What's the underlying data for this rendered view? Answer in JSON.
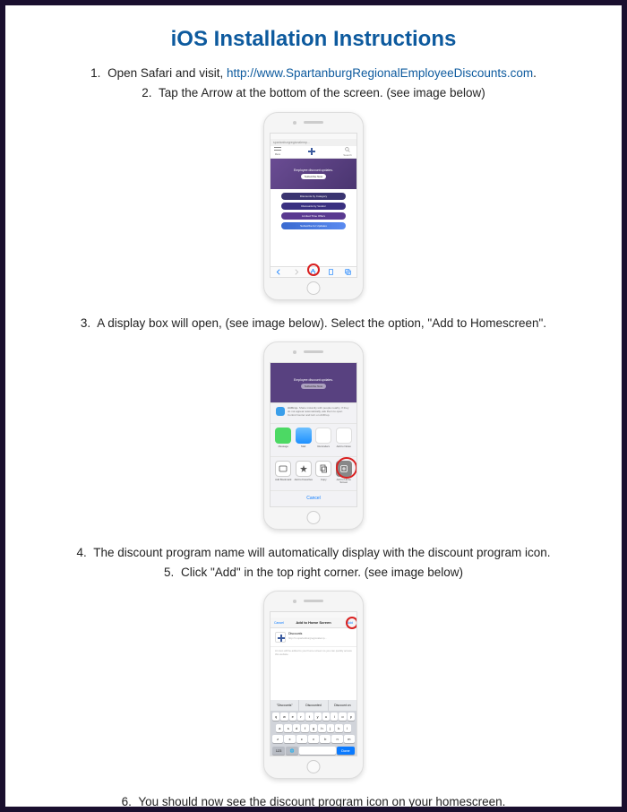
{
  "title": "iOS Installation Instructions",
  "steps": {
    "s1_pre": "Open Safari and visit, ",
    "s1_link": "http://www.SpartanburgRegionalEmployeeDiscounts.com",
    "s1_post": ".",
    "s2": "Tap the Arrow at the bottom of the screen. (see image below)",
    "s3": "A display box will open, (see image below).  Select the option, \"Add to Homescreen\".",
    "s4": "The discount program name will automatically display with the discount program icon.",
    "s5": "Click \"Add\" in the top right corner. (see image below)",
    "s6": "You should now see the discount program icon on your homescreen."
  },
  "nums": {
    "n1": "1.",
    "n2": "2.",
    "n3": "3.",
    "n4": "4.",
    "n5": "5.",
    "n6": "6."
  },
  "phone1": {
    "url_bar": "spartanburgregionalemp...",
    "menu_label": "Menu",
    "search_label": "Search",
    "hero_title": "Employee discount updates.",
    "hero_btn": "Subscribe Now",
    "pill1": "Discounts by Category",
    "pill2": "Discounts by Vendor",
    "pill3": "Limited Time Offers",
    "pill4": "Subscribe for Updates"
  },
  "phone2": {
    "hero_title": "Employee discount updates.",
    "hero_btn": "Subscribe Now",
    "airdrop_title": "AirDrop.",
    "airdrop_text": "Share instantly with people nearby. If they do not appear automatically, ask them to open Control Center and turn on AirDrop.",
    "row1": {
      "t1": "Message",
      "t2": "Mail",
      "t3": "Reminders",
      "t4": "Add to Notes"
    },
    "row2": {
      "t1": "Add Bookmark",
      "t2": "Add to Favorites",
      "t3": "Copy",
      "t4": "Add to Home Screen"
    },
    "cancel": "Cancel"
  },
  "phone3": {
    "cancel": "Cancel",
    "nav_title": "Add to Home Screen",
    "add": "Add",
    "name_field": "Discounts",
    "url_field": "http://m.spartanburgregionalemp...",
    "hint": "An icon will be added to your home screen so you can quickly access this website.",
    "sugg1": "\"Discounts\"",
    "sugg2": "Discounted",
    "sugg3": "Discount on",
    "keys_r1": [
      "q",
      "w",
      "e",
      "r",
      "t",
      "y",
      "u",
      "i",
      "o",
      "p"
    ],
    "keys_r2": [
      "a",
      "s",
      "d",
      "f",
      "g",
      "h",
      "j",
      "k",
      "l"
    ],
    "keys_r3": [
      "z",
      "x",
      "c",
      "v",
      "b",
      "n",
      "m"
    ]
  }
}
